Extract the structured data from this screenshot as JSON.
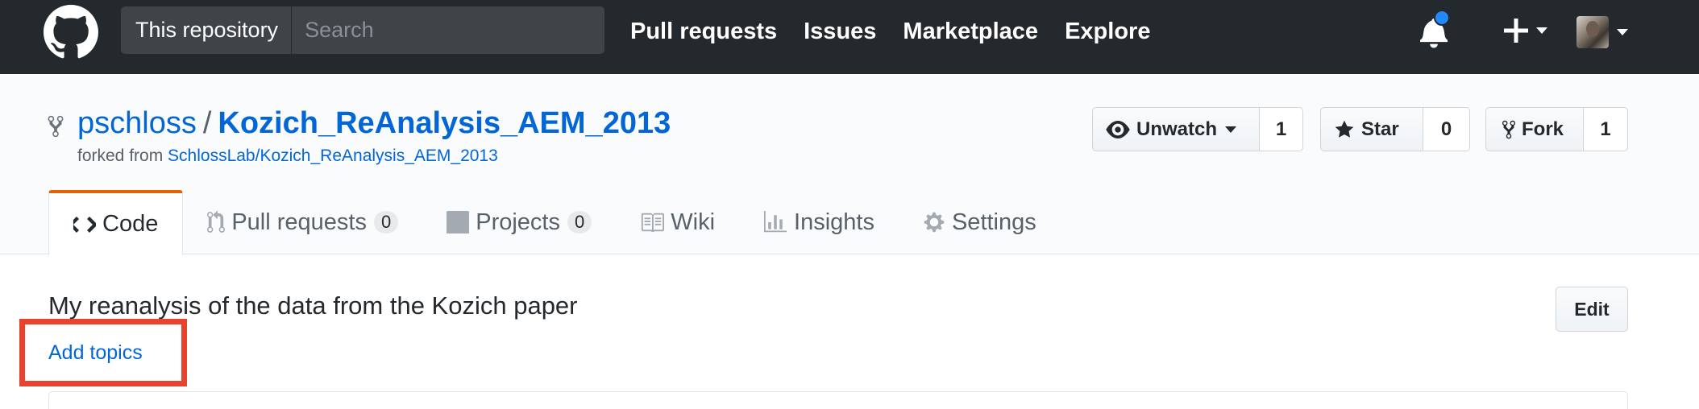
{
  "header": {
    "scope_label": "This repository",
    "search_placeholder": "Search",
    "nav": [
      "Pull requests",
      "Issues",
      "Marketplace",
      "Explore"
    ],
    "notification_dot_color": "#2188ff"
  },
  "repo": {
    "owner": "pschloss",
    "separator": "/",
    "name": "Kozich_ReAnalysis_AEM_2013",
    "forked_prefix": "forked from",
    "forked_source": "SchlossLab/Kozich_ReAnalysis_AEM_2013"
  },
  "actions": {
    "watch_label": "Unwatch",
    "watch_count": "1",
    "star_label": "Star",
    "star_count": "0",
    "fork_label": "Fork",
    "fork_count": "1"
  },
  "tabs": {
    "code": "Code",
    "pull_requests": "Pull requests",
    "pull_requests_count": "0",
    "projects": "Projects",
    "projects_count": "0",
    "wiki": "Wiki",
    "insights": "Insights",
    "settings": "Settings",
    "selected_accent": "#e36209"
  },
  "content": {
    "description": "My reanalysis of the data from the Kozich paper",
    "edit_label": "Edit",
    "add_topics": "Add topics",
    "annotation_color": "#e8432e"
  }
}
